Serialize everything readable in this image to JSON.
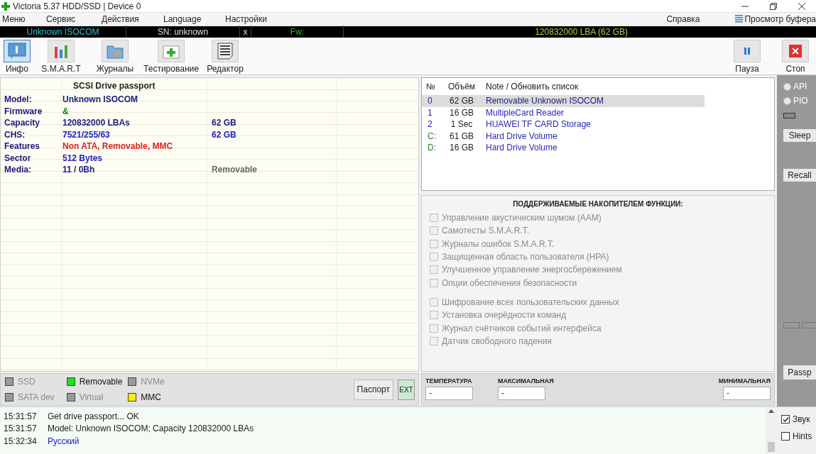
{
  "window": {
    "title": "Victoria 5.37 HDD/SSD | Device 0"
  },
  "menu": [
    "Меню",
    "Сервис",
    "Действия",
    "Language",
    "Настройки"
  ],
  "menu_right": {
    "help": "Справка",
    "buffer": "Просмотр буфера"
  },
  "info_bar": {
    "model": "Unknown ISOCOM",
    "serial": "SN: unknown",
    "close": "x",
    "firmware": "Fw:",
    "capacity": "120832000 LBA (62 GB)"
  },
  "toolbar": [
    {
      "label": "Инфо",
      "kind": "info",
      "selected": true
    },
    {
      "label": "S.M.A.R.T",
      "kind": "smart",
      "selected": false
    },
    {
      "label": "Журналы",
      "kind": "logs",
      "selected": false
    },
    {
      "label": "Тестирование",
      "kind": "test",
      "selected": false
    },
    {
      "label": "Редактор",
      "kind": "editor",
      "selected": false
    }
  ],
  "toolbar_right": [
    {
      "label": "Пауза",
      "kind": "pause"
    },
    {
      "label": "Стоп",
      "kind": "stop"
    }
  ],
  "passport": {
    "title": "SCSI  Drive passport",
    "rows": [
      {
        "label": "Model:",
        "value": "Unknown ISOCOM",
        "color": "#1a1a80"
      },
      {
        "label": "Firmware",
        "value": "&",
        "color": "#108010"
      },
      {
        "label": "Capacity",
        "value": "120832000 LBAs",
        "extra": "62 GB",
        "color": "#1a1a80"
      },
      {
        "label": "CHS:",
        "value": "7521/255/63",
        "extra": "62 GB",
        "color": "#2020c0"
      },
      {
        "label": "Features",
        "value": "Non ATA, Removable, MMC",
        "color": "#e02020"
      },
      {
        "label": "Sector",
        "value": "512 Bytes",
        "color": "#2020c0"
      },
      {
        "label": "Media:",
        "value": "11 / 0Bh",
        "extra": "Removable",
        "color": "#1a1a80"
      }
    ]
  },
  "legend": [
    {
      "label": "SSD",
      "color": "#9a9a9a",
      "disabled": true
    },
    {
      "label": "SATA dev",
      "color": "#9a9a9a",
      "disabled": true
    },
    {
      "label": "Removable",
      "color": "#22dd22",
      "disabled": false
    },
    {
      "label": "Virtual",
      "color": "#9a9a9a",
      "disabled": true
    },
    {
      "label": "NVMe",
      "color": "#9a9a9a",
      "disabled": true
    },
    {
      "label": "MMC",
      "color": "#ffee00",
      "disabled": false
    }
  ],
  "passport_button": "Паспорт",
  "ext_button": "EXT",
  "drives": {
    "columns": [
      "№",
      "Объём",
      "Note / Обновить список"
    ],
    "rows": [
      {
        "no": "0",
        "size": "62 GB",
        "note": "Removable Unknown ISOCOM",
        "color": "#2020c0",
        "selected": true
      },
      {
        "no": "1",
        "size": "16 GB",
        "note": "MultipleCard  Reader",
        "color": "#2020c0",
        "selected": false
      },
      {
        "no": "2",
        "size": "1 Sec",
        "note": "HUAWEI  TF CARD Storage",
        "color": "#2020c0",
        "selected": false
      },
      {
        "no": "C:",
        "size": "61 GB",
        "note": "Hard Drive Volume",
        "color": "#308030",
        "selected": false
      },
      {
        "no": "D:",
        "size": "16 GB",
        "note": "Hard Drive Volume",
        "color": "#308030",
        "selected": false
      }
    ]
  },
  "features": {
    "title": "ПОДДЕРЖИВАЕМЫЕ НАКОПИТЕЛЕМ ФУНКЦИИ:",
    "groups": [
      [
        {
          "label": "Управление акустическим шумом (AAM)",
          "checked": false,
          "disabled": true
        },
        {
          "label": "Самотесты S.M.A.R.T.",
          "checked": false,
          "disabled": true
        },
        {
          "label": "Журналы ошибок S.M.A.R.T.",
          "checked": false,
          "disabled": true
        },
        {
          "label": "Защищенная область пользователя (HPA)",
          "checked": false,
          "disabled": true
        },
        {
          "label": "Улучшенное управление энергосбережением",
          "checked": false,
          "disabled": true
        },
        {
          "label": "Опции обеспечения безопасности",
          "checked": false,
          "disabled": true
        }
      ],
      [
        {
          "label": "Шифрование всех пользовательских данных",
          "checked": false,
          "disabled": true
        },
        {
          "label": "Установка очерёдности команд",
          "checked": false,
          "disabled": true
        },
        {
          "label": "Журнал счётчиков событий интерфейса",
          "checked": false,
          "disabled": true
        },
        {
          "label": "Датчик свободного падения",
          "checked": false,
          "disabled": true
        }
      ]
    ]
  },
  "temperature": [
    {
      "label": "ТЕМПЕРАТУРА",
      "value": "-"
    },
    {
      "label": "МАКСИМАЛЬНАЯ",
      "value": "-"
    },
    {
      "label": "МИНИМАЛЬНАЯ",
      "value": "-"
    }
  ],
  "side": {
    "radios": [
      {
        "label": "API",
        "selected": false,
        "disabled": true
      },
      {
        "label": "PIO",
        "selected": false,
        "disabled": true
      }
    ],
    "sleep": "Sleep",
    "recall": "Recall",
    "passp": "Passp"
  },
  "log": [
    {
      "time": "15:31:57",
      "text": "Get drive passport... OK",
      "color": "#202020"
    },
    {
      "time": "15:31:57",
      "text": "Model: Unknown ISOCOM; Capacity 120832000 LBAs",
      "color": "#202020"
    },
    {
      "time": "15:32:34",
      "text": "Русский",
      "color": "#2020c0"
    }
  ],
  "log_options": [
    {
      "label": "Звук",
      "checked": true
    },
    {
      "label": "Hints",
      "checked": false
    }
  ]
}
